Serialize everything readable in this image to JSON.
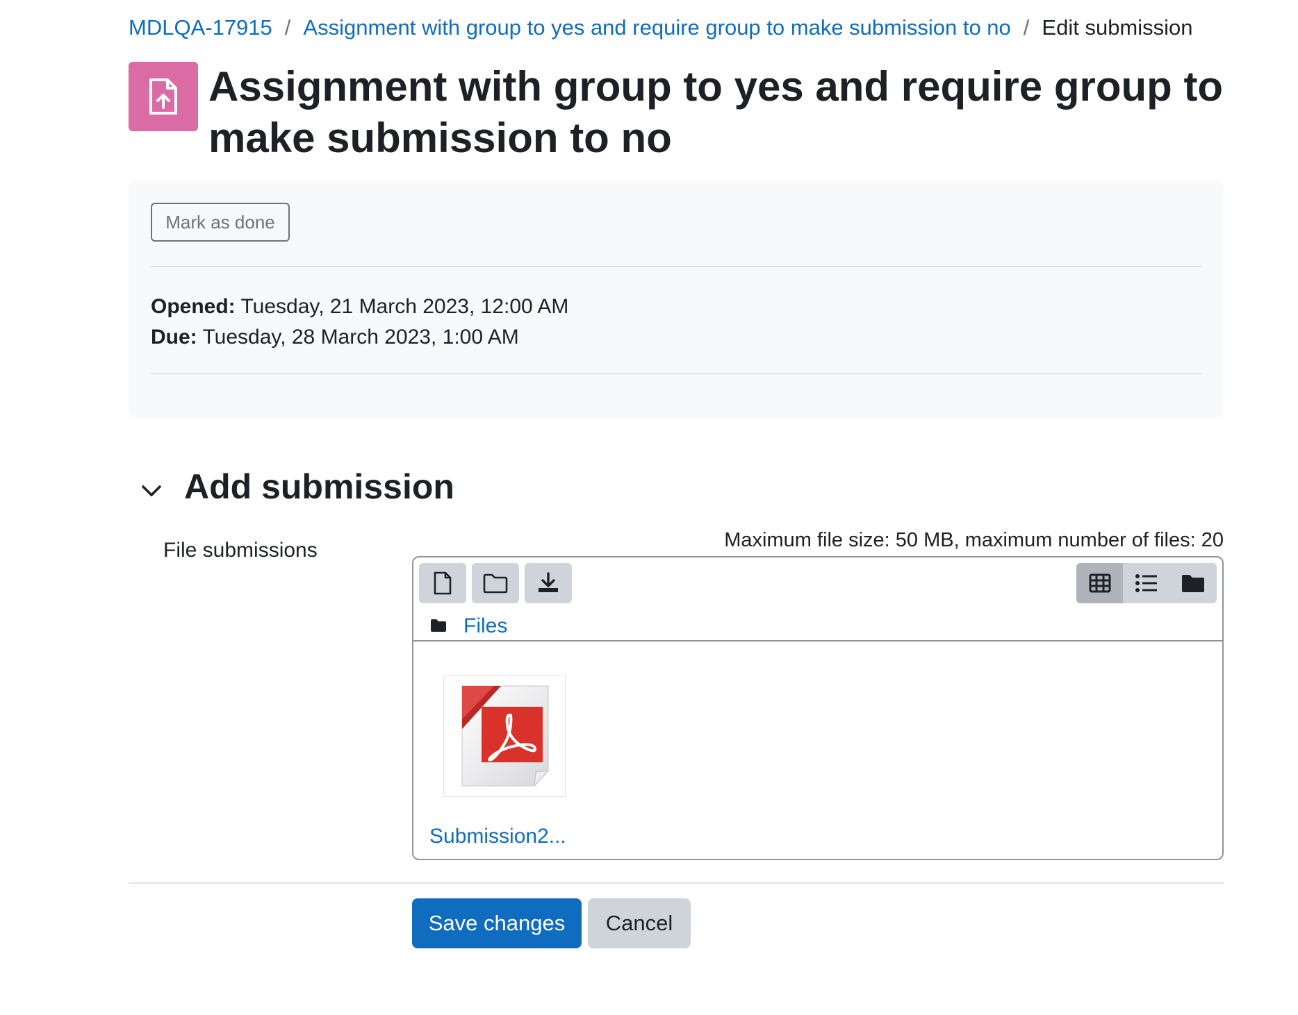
{
  "breadcrumb": {
    "items": [
      "MDLQA-17915",
      "Assignment with group to yes and require group to make submission to no"
    ],
    "separator": "/",
    "current": "Edit submission"
  },
  "activity": {
    "icon": "assignment-upload-icon",
    "title": "Assignment with group to yes and require group to make submission to no"
  },
  "completion": {
    "mark_done_label": "Mark as done"
  },
  "dates": {
    "opened_label": "Opened:",
    "opened_value": "Tuesday, 21 March 2023, 12:00 AM",
    "due_label": "Due:",
    "due_value": "Tuesday, 28 March 2023, 1:00 AM"
  },
  "submission_section": {
    "title": "Add submission",
    "file_label": "File submissions",
    "limits_text": "Maximum file size: 50 MB, maximum number of files: 20"
  },
  "file_manager": {
    "toolbar_icons": [
      "add-file-icon",
      "create-folder-icon",
      "download-icon"
    ],
    "view_icons": [
      "grid-view-icon",
      "list-view-icon",
      "tree-view-icon"
    ],
    "active_view": "grid",
    "path_label": "Files",
    "files": [
      {
        "name": "Submission2...",
        "icon": "pdf-file-icon"
      }
    ]
  },
  "actions": {
    "save_label": "Save changes",
    "cancel_label": "Cancel"
  },
  "colors": {
    "link": "#0f6cbf",
    "primary_button": "#0f6cbf",
    "activity_icon_bg": "#db6ba5",
    "secondary_button": "#ced4da"
  }
}
